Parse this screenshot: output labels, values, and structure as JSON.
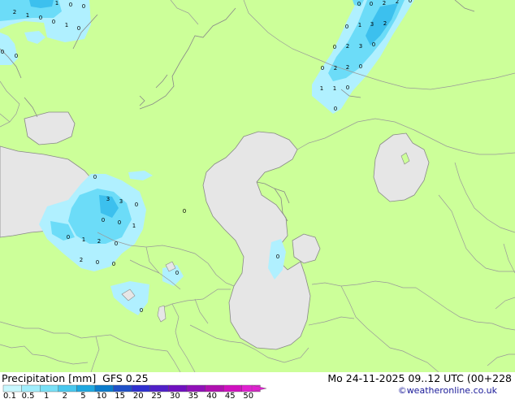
{
  "colors": {
    "land": "#ccff99",
    "water": "#e6e6e6",
    "coast": "#888888",
    "border": "#999999",
    "precip_light": "#b0f0ff",
    "precip_mid": "#6cdcf8",
    "precip_heavy": "#3cc0ee"
  },
  "legend": {
    "title": "Precipitation [mm]",
    "model": "GFS 0.25",
    "datetime": "Mo 24-11-2025 09..12 UTC (00+228",
    "credit": "©weatheronline.co.uk",
    "scale_labels": [
      "0.1",
      "0.5",
      "1",
      "2",
      "5",
      "10",
      "15",
      "20",
      "25",
      "30",
      "35",
      "40",
      "45",
      "50"
    ],
    "scale_colors": [
      "#c8f8ff",
      "#a0eefc",
      "#78e0f6",
      "#48c8ee",
      "#1ea8e0",
      "#0a7ccc",
      "#2050c8",
      "#3030d0",
      "#5020c8",
      "#7010c0",
      "#9010b8",
      "#b010b0",
      "#d010c0",
      "#e020d0"
    ]
  },
  "map_labels": [
    {
      "text": "1",
      "location": "nw-corner"
    },
    {
      "text": "2",
      "location": "nw-corner"
    },
    {
      "text": "1",
      "location": "nw-corner"
    },
    {
      "text": "0",
      "location": "nw-corner"
    },
    {
      "text": "0",
      "location": "nw-corner"
    },
    {
      "text": "1",
      "location": "nw-corner"
    },
    {
      "text": "0",
      "location": "nw-corner"
    },
    {
      "text": "0",
      "location": "nw-corner"
    },
    {
      "text": "0",
      "location": "nw-corner"
    },
    {
      "text": "0",
      "location": "nw-corner"
    },
    {
      "text": "0",
      "location": "nw-corner"
    },
    {
      "text": "0",
      "location": "northeast-band"
    },
    {
      "text": "0",
      "location": "northeast-band"
    },
    {
      "text": "2",
      "location": "northeast-band"
    },
    {
      "text": "2",
      "location": "northeast-band"
    },
    {
      "text": "0",
      "location": "northeast-band"
    },
    {
      "text": "0",
      "location": "northeast-band"
    },
    {
      "text": "1",
      "location": "northeast-band"
    },
    {
      "text": "3",
      "location": "northeast-band"
    },
    {
      "text": "2",
      "location": "northeast-band"
    },
    {
      "text": "0",
      "location": "northeast-band"
    },
    {
      "text": "2",
      "location": "northeast-band"
    },
    {
      "text": "3",
      "location": "northeast-band"
    },
    {
      "text": "0",
      "location": "northeast-band"
    },
    {
      "text": "0",
      "location": "northeast-band"
    },
    {
      "text": "2",
      "location": "northeast-band"
    },
    {
      "text": "2",
      "location": "northeast-band"
    },
    {
      "text": "0",
      "location": "northeast-band"
    },
    {
      "text": "1",
      "location": "northeast-band"
    },
    {
      "text": "1",
      "location": "northeast-band"
    },
    {
      "text": "0",
      "location": "northeast-band"
    },
    {
      "text": "0",
      "location": "northeast-band"
    },
    {
      "text": "0",
      "location": "black-sea-east"
    },
    {
      "text": "3",
      "location": "black-sea-east"
    },
    {
      "text": "3",
      "location": "black-sea-east"
    },
    {
      "text": "0",
      "location": "black-sea-east"
    },
    {
      "text": "0",
      "location": "black-sea-east"
    },
    {
      "text": "0",
      "location": "black-sea-east"
    },
    {
      "text": "1",
      "location": "black-sea-east"
    },
    {
      "text": "0",
      "location": "black-sea-east"
    },
    {
      "text": "1",
      "location": "black-sea-east"
    },
    {
      "text": "2",
      "location": "black-sea-east"
    },
    {
      "text": "0",
      "location": "black-sea-east"
    },
    {
      "text": "2",
      "location": "black-sea-east"
    },
    {
      "text": "0",
      "location": "black-sea-east"
    },
    {
      "text": "0",
      "location": "black-sea-east"
    },
    {
      "text": "0",
      "location": "caucasus"
    },
    {
      "text": "0",
      "location": "caucasus"
    },
    {
      "text": "0",
      "location": "caspian-middle"
    },
    {
      "text": "0",
      "location": "south"
    }
  ]
}
